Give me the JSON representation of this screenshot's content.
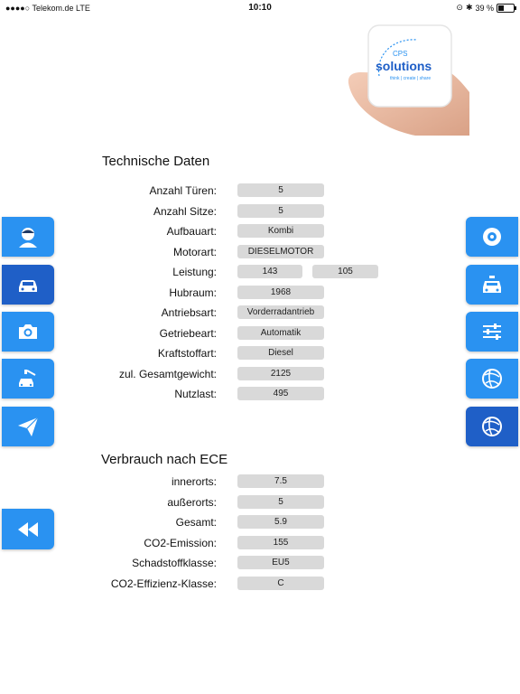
{
  "status": {
    "left": "●●●●○ Telekom.de  LTE",
    "time": "10:10",
    "right": "39 %",
    "battery_level": 0.39
  },
  "logo": {
    "line1": "CPS",
    "line2": "solutions",
    "line3": "think | create | share"
  },
  "technische_daten": {
    "title": "Technische Daten",
    "rows": [
      {
        "label": "Anzahl Türen:",
        "values": [
          "5"
        ]
      },
      {
        "label": "Anzahl Sitze:",
        "values": [
          "5"
        ]
      },
      {
        "label": "Aufbauart:",
        "values": [
          "Kombi"
        ]
      },
      {
        "label": "Motorart:",
        "values": [
          "DIESELMOTOR"
        ]
      },
      {
        "label": "Leistung:",
        "values": [
          "143",
          "105"
        ]
      },
      {
        "label": "Hubraum:",
        "values": [
          "1968"
        ]
      },
      {
        "label": "Antriebsart:",
        "values": [
          "Vorderradantrieb"
        ]
      },
      {
        "label": "Getriebeart:",
        "values": [
          "Automatik"
        ]
      },
      {
        "label": "Kraftstoffart:",
        "values": [
          "Diesel"
        ]
      },
      {
        "label": "zul. Gesamtgewicht:",
        "values": [
          "2125"
        ]
      },
      {
        "label": "Nutzlast:",
        "values": [
          "495"
        ]
      }
    ]
  },
  "verbrauch": {
    "title": "Verbrauch nach ECE",
    "rows": [
      {
        "label": "innerorts:",
        "values": [
          "7.5"
        ]
      },
      {
        "label": "außerorts:",
        "values": [
          "5"
        ]
      },
      {
        "label": "Gesamt:",
        "values": [
          "5.9"
        ]
      },
      {
        "label": "CO2-Emission:",
        "values": [
          "155"
        ]
      },
      {
        "label": "Schadstoffklasse:",
        "values": [
          "EU5"
        ]
      },
      {
        "label": "CO2-Effizienz-Klasse:",
        "values": [
          "C"
        ]
      }
    ]
  },
  "left_nav": [
    {
      "icon": "person-icon"
    },
    {
      "icon": "car-icon",
      "active": true
    },
    {
      "icon": "camera-icon"
    },
    {
      "icon": "car-wash-icon"
    },
    {
      "icon": "send-icon"
    },
    {
      "icon": "rewind-icon"
    }
  ],
  "right_nav": [
    {
      "icon": "tire-icon"
    },
    {
      "icon": "taxi-icon"
    },
    {
      "icon": "sliders-icon"
    },
    {
      "icon": "globe-icon"
    },
    {
      "icon": "globe-icon",
      "active": true
    }
  ],
  "colors": {
    "accent": "#2a92f1",
    "accent_active": "#1f5fc7",
    "pill": "#d9d9d9"
  }
}
